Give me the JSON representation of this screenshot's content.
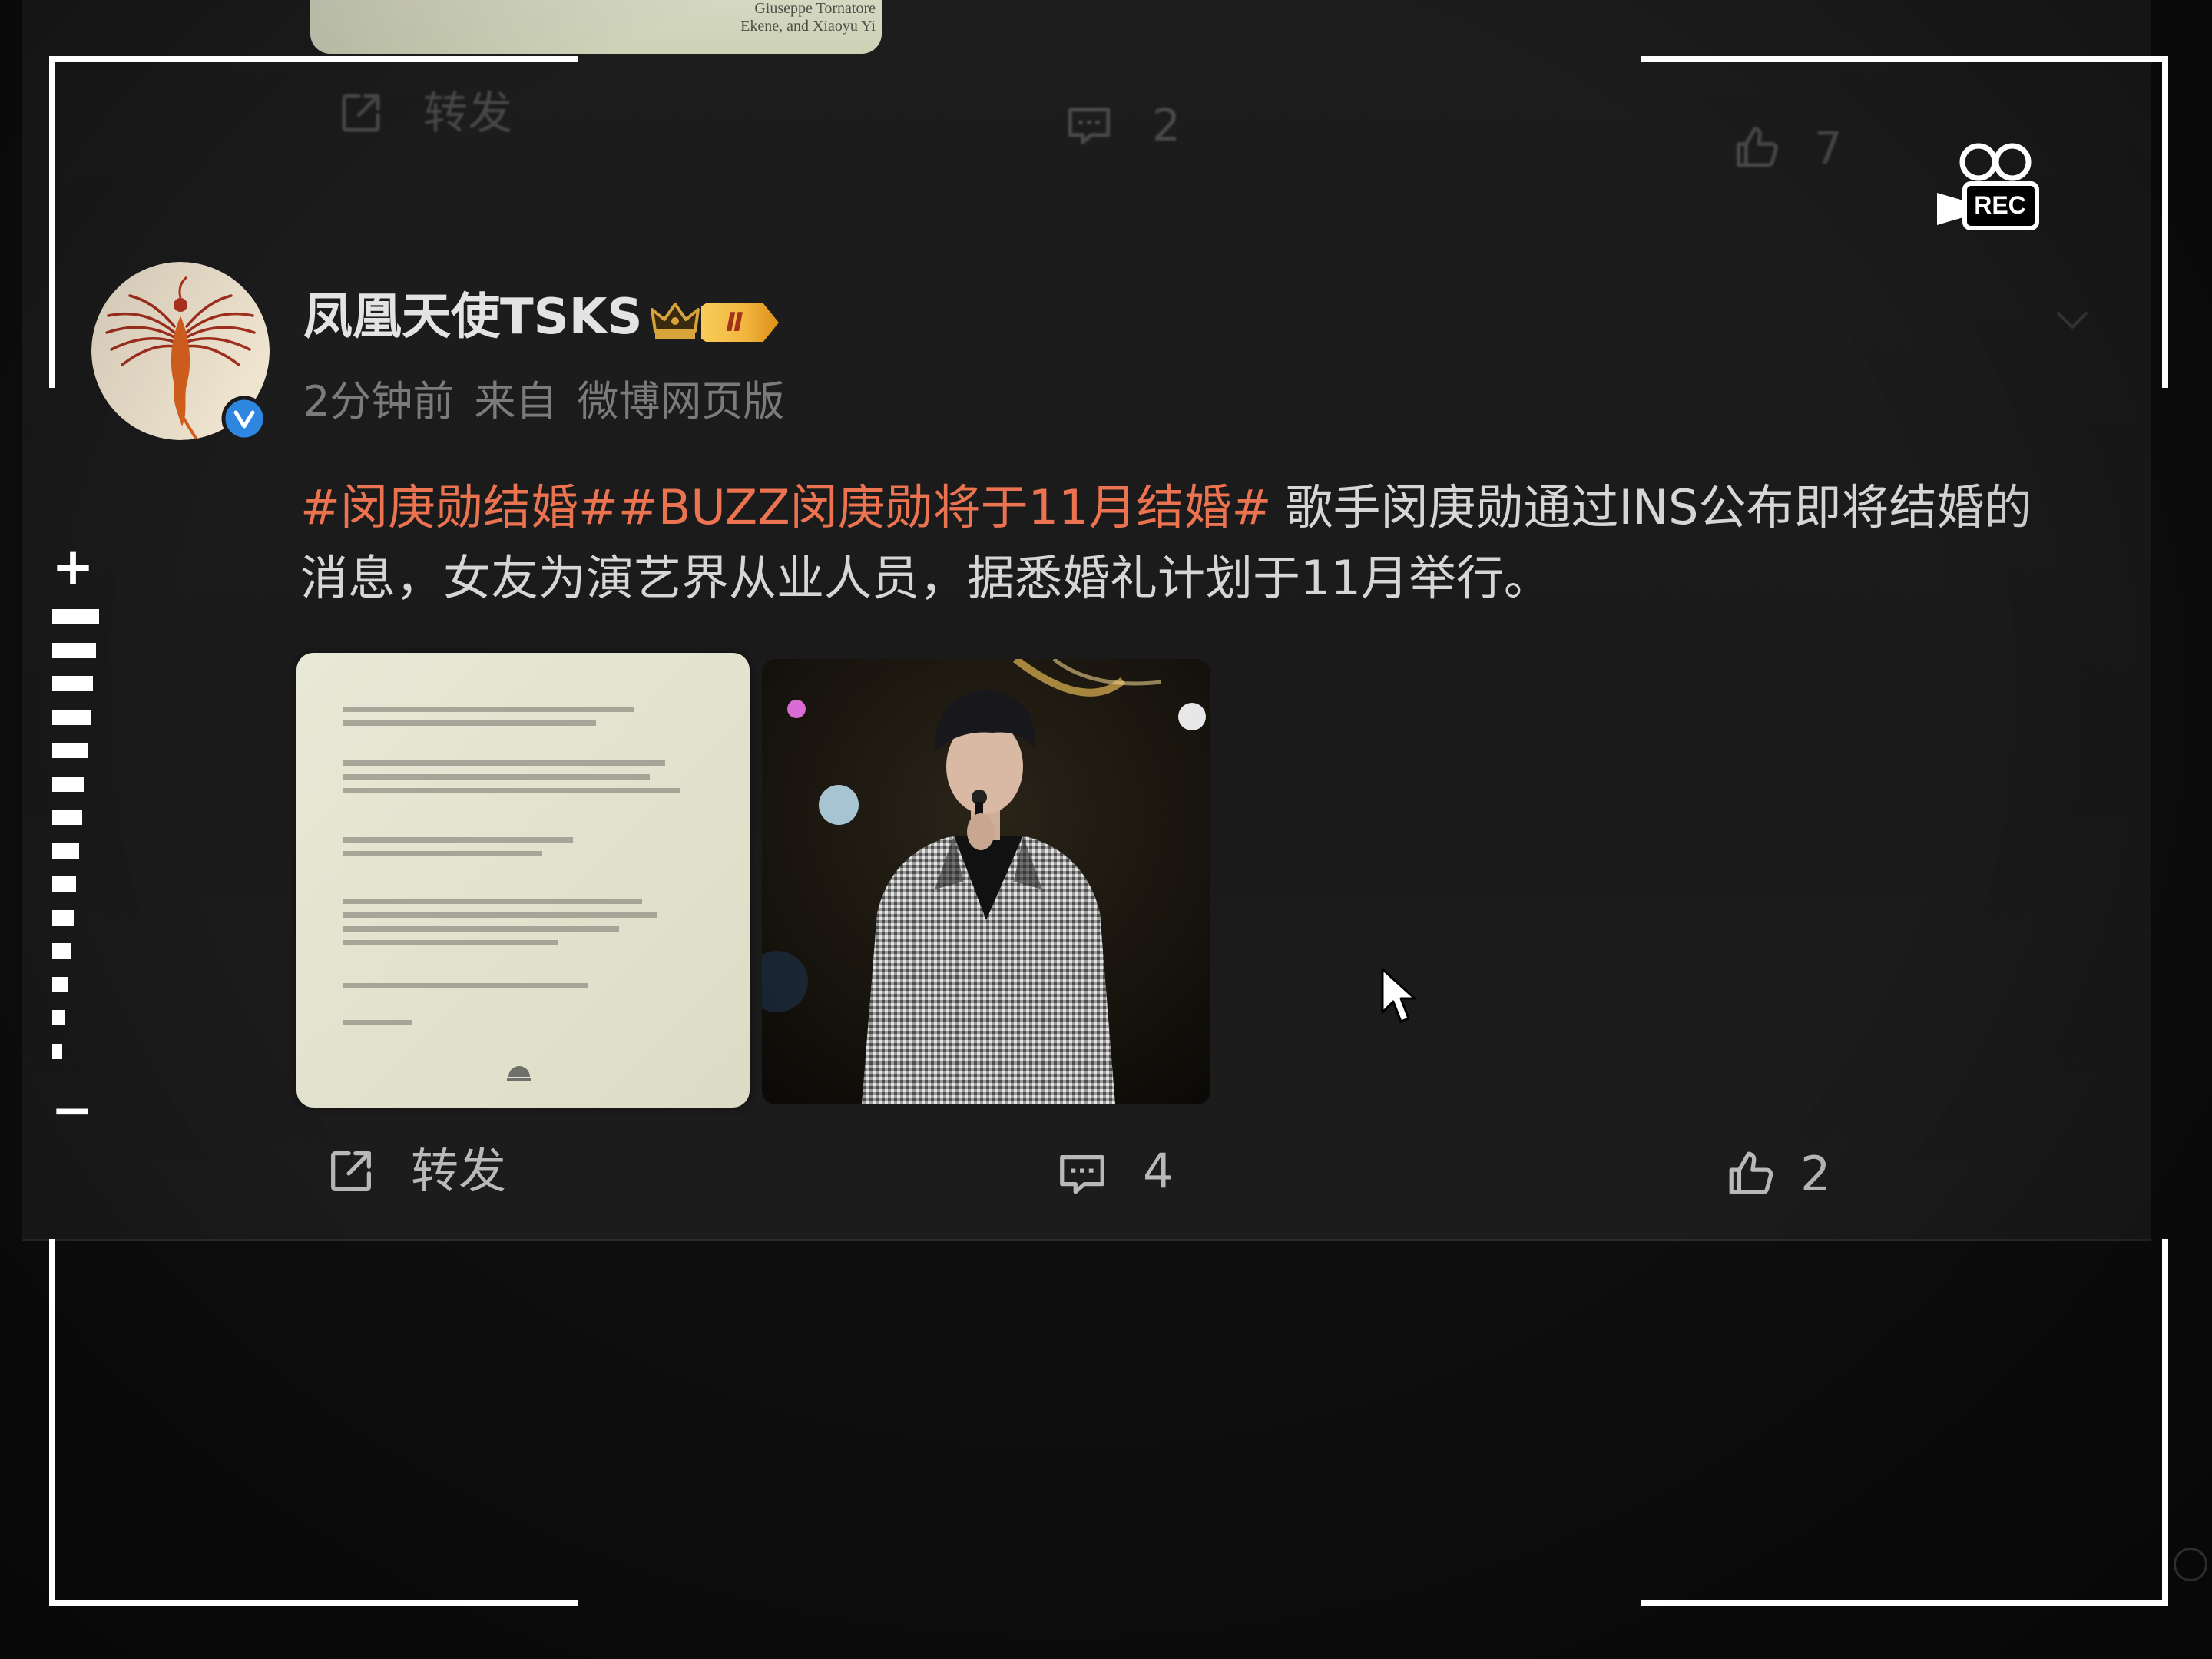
{
  "previous_post": {
    "image_caption_lines": [
      "Giuseppe Tornatore",
      "Ekene, and Xiaoyu Yi"
    ],
    "actions": {
      "repost_label": "转发",
      "comment_count": "2",
      "like_count": "7"
    }
  },
  "post": {
    "author": {
      "name": "凤凰天使TSKS",
      "member_level": "Ⅱ",
      "verified": true,
      "avatar_icon": "phoenix-avatar"
    },
    "meta": {
      "time": "2分钟前",
      "source_prefix": "来自",
      "source": "微博网页版"
    },
    "topics": [
      "#闵庚勋结婚#",
      "#BUZZ闵庚勋将于11月结婚#"
    ],
    "body": "歌手闵庚勋通过INS公布即将结婚的消息，女友为演艺界从业人员，据悉婚礼计划于11月举行。",
    "actions": {
      "repost_label": "转发",
      "comment_count": "4",
      "like_count": "2"
    }
  },
  "camera_overlay": {
    "rec_label": "REC",
    "zoom_in_label": "+",
    "zoom_out_label": "−"
  },
  "icons": {
    "repost": "share-icon",
    "comment": "comment-icon",
    "like": "thumbs-up-icon",
    "verified": "verified-v-icon",
    "crown": "crown-icon",
    "menu": "chevron-down-icon",
    "cursor": "mouse-pointer-icon",
    "record": "video-camera-rec-icon"
  },
  "colors": {
    "topic": "#eb7350",
    "text": "#d6d6d6",
    "meta": "#7b7b7b",
    "action": "#b9b9b9",
    "verified": "#2f86e0",
    "gold": "#f2b640",
    "overlay": "#ffffff"
  }
}
